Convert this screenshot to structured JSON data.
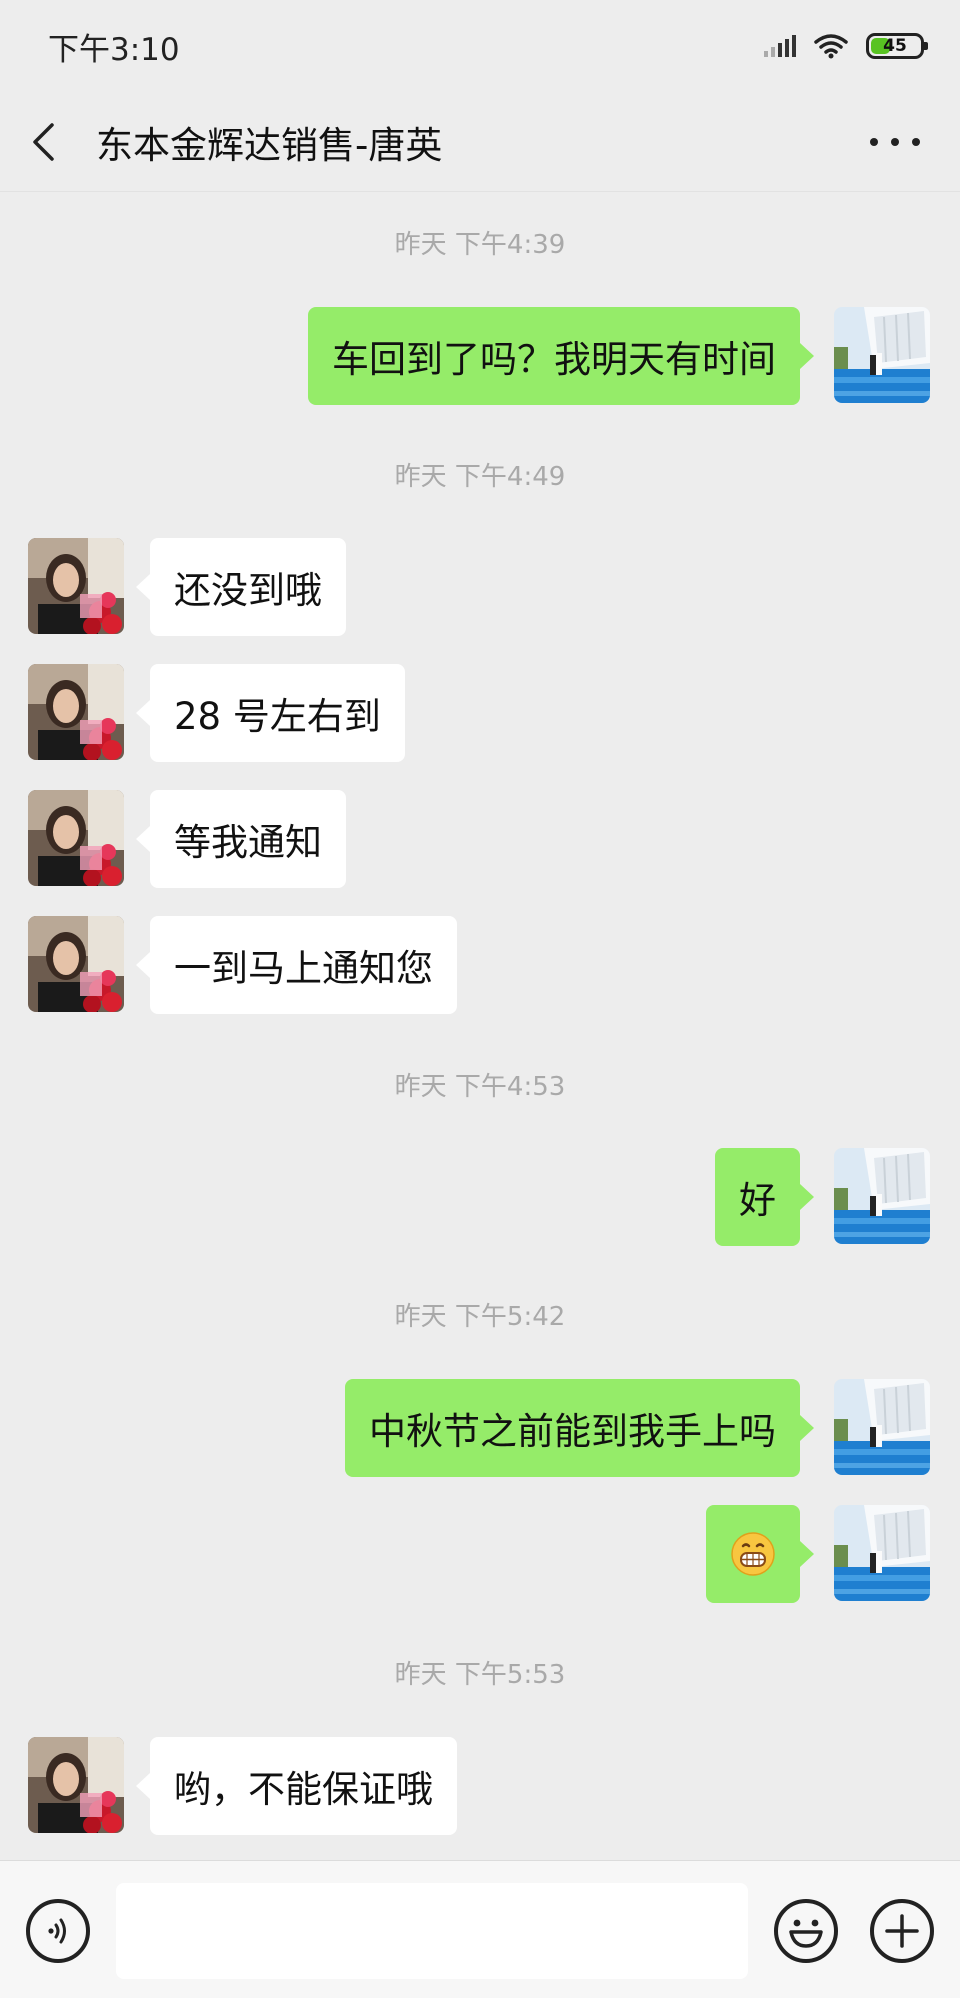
{
  "status_bar": {
    "time": "下午3:10",
    "battery_level": "45",
    "battery_color": "#58c322"
  },
  "header": {
    "title": "东本金辉达销售-唐英",
    "back_icon": "chevron-left-icon",
    "more_icon": "more-horizontal-icon"
  },
  "messages": {
    "ts1": "昨天 下午4:39",
    "m1": "车回到了吗？我明天有时间",
    "ts2": "昨天 下午4:49",
    "m2": "还没到哦",
    "m3": "28 号左右到",
    "m4": "等我通知",
    "m5": "一到马上通知您",
    "ts3": "昨天 下午4:53",
    "m6": "好",
    "ts4": "昨天 下午5:42",
    "m7": "中秋节之前能到我手上吗",
    "m8_emoji": "grinning-teeth-emoji",
    "ts5": "昨天 下午5:53",
    "m9": "哟，不能保证哦"
  },
  "input_bar": {
    "voice_icon": "voice-icon",
    "message_value": "",
    "emoji_icon": "smiley-icon",
    "plus_icon": "plus-icon"
  },
  "colors": {
    "background": "#ededed",
    "outgoing_bubble": "#95ec69",
    "incoming_bubble": "#ffffff",
    "timestamp": "#a9a9a9"
  }
}
